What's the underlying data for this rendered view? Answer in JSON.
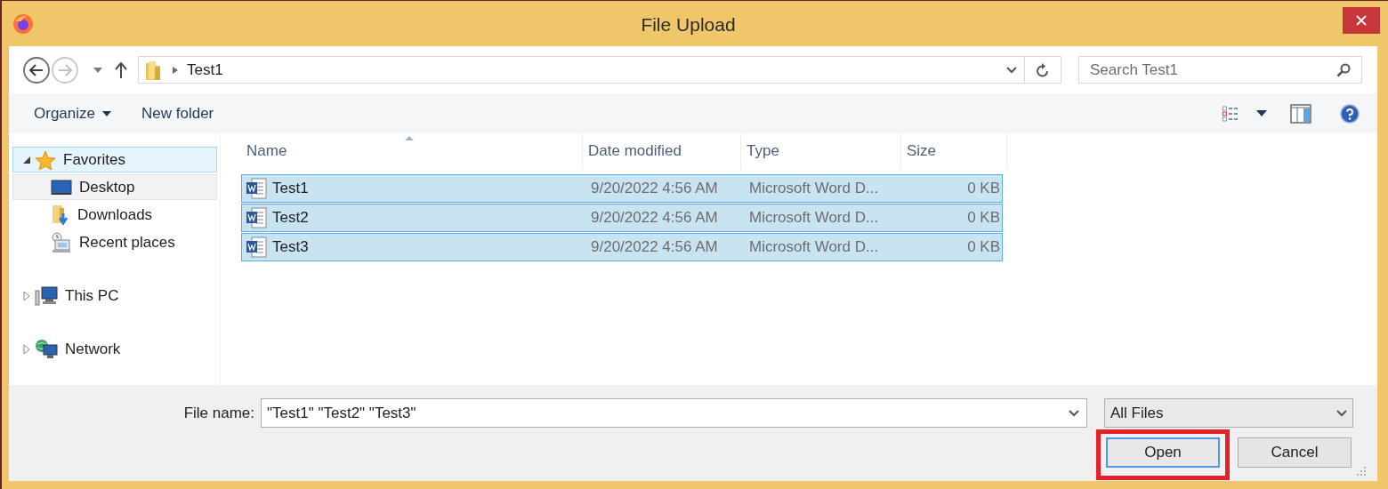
{
  "window": {
    "title": "File Upload"
  },
  "address": {
    "path": "Test1",
    "search_placeholder": "Search Test1"
  },
  "toolbar": [
    {
      "label": "Organize",
      "dropdown": true
    },
    {
      "label": "New folder",
      "dropdown": false
    }
  ],
  "nav": [
    {
      "label": "Favorites",
      "kind": "favorites",
      "expanded": true,
      "selected": true,
      "hovered": false,
      "children": [
        {
          "label": "Desktop",
          "kind": "desktop",
          "selected": false,
          "hovered": true
        },
        {
          "label": "Downloads",
          "kind": "downloads",
          "selected": false,
          "hovered": false
        },
        {
          "label": "Recent places",
          "kind": "recent",
          "selected": false,
          "hovered": false
        }
      ]
    },
    {
      "label": "This PC",
      "kind": "pc",
      "expanded": false,
      "selected": false,
      "hovered": false
    },
    {
      "label": "Network",
      "kind": "network",
      "expanded": false,
      "selected": false,
      "hovered": false
    }
  ],
  "table": {
    "columns": [
      {
        "label": "Name",
        "sorted": true
      },
      {
        "label": "Date modified",
        "sorted": false
      },
      {
        "label": "Type",
        "sorted": false
      },
      {
        "label": "Size",
        "sorted": false
      }
    ],
    "rows": [
      {
        "name": "Test1",
        "date": "9/20/2022 4:56 AM",
        "type": "Microsoft Word D...",
        "size": "0 KB",
        "selected": true
      },
      {
        "name": "Test2",
        "date": "9/20/2022 4:56 AM",
        "type": "Microsoft Word D...",
        "size": "0 KB",
        "selected": true
      },
      {
        "name": "Test3",
        "date": "9/20/2022 4:56 AM",
        "type": "Microsoft Word D...",
        "size": "0 KB",
        "selected": true
      }
    ]
  },
  "file_name": {
    "label": "File name:",
    "value": "\"Test1\" \"Test2\" \"Test3\""
  },
  "file_type": {
    "value": "All Files"
  },
  "buttons": [
    {
      "label": "Open",
      "default": true,
      "highlighted": true
    },
    {
      "label": "Cancel",
      "default": false,
      "highlighted": false
    }
  ]
}
